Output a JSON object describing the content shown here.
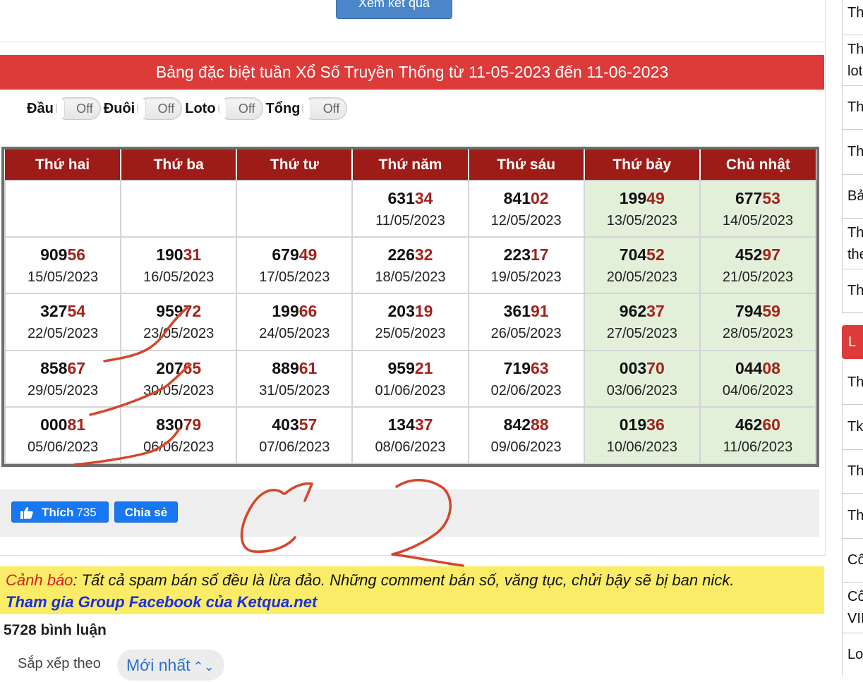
{
  "top": {
    "button_label": "Xem kết quả"
  },
  "banner": {
    "title": "Bảng đặc biệt tuần Xổ Số Truyền Thống từ 11-05-2023 đến 11-06-2023"
  },
  "toggles": [
    {
      "label": "Đầu",
      "state": "Off"
    },
    {
      "label": "Đuôi",
      "state": "Off"
    },
    {
      "label": "Loto",
      "state": "Off"
    },
    {
      "label": "Tổng",
      "state": "Off"
    }
  ],
  "table": {
    "headers": [
      "Thứ hai",
      "Thứ ba",
      "Thứ tư",
      "Thứ năm",
      "Thứ sáu",
      "Thứ bảy",
      "Chủ nhật"
    ],
    "rows": [
      [
        {
          "head": "",
          "tail": "",
          "date": ""
        },
        {
          "head": "",
          "tail": "",
          "date": ""
        },
        {
          "head": "",
          "tail": "",
          "date": ""
        },
        {
          "head": "631",
          "tail": "34",
          "date": "11/05/2023"
        },
        {
          "head": "841",
          "tail": "02",
          "date": "12/05/2023"
        },
        {
          "head": "199",
          "tail": "49",
          "date": "13/05/2023"
        },
        {
          "head": "677",
          "tail": "53",
          "date": "14/05/2023"
        }
      ],
      [
        {
          "head": "909",
          "tail": "56",
          "date": "15/05/2023"
        },
        {
          "head": "190",
          "tail": "31",
          "date": "16/05/2023"
        },
        {
          "head": "679",
          "tail": "49",
          "date": "17/05/2023"
        },
        {
          "head": "226",
          "tail": "32",
          "date": "18/05/2023"
        },
        {
          "head": "223",
          "tail": "17",
          "date": "19/05/2023"
        },
        {
          "head": "704",
          "tail": "52",
          "date": "20/05/2023"
        },
        {
          "head": "452",
          "tail": "97",
          "date": "21/05/2023"
        }
      ],
      [
        {
          "head": "327",
          "tail": "54",
          "date": "22/05/2023"
        },
        {
          "head": "959",
          "tail": "72",
          "date": "23/05/2023"
        },
        {
          "head": "199",
          "tail": "66",
          "date": "24/05/2023"
        },
        {
          "head": "203",
          "tail": "19",
          "date": "25/05/2023"
        },
        {
          "head": "361",
          "tail": "91",
          "date": "26/05/2023"
        },
        {
          "head": "962",
          "tail": "37",
          "date": "27/05/2023"
        },
        {
          "head": "794",
          "tail": "59",
          "date": "28/05/2023"
        }
      ],
      [
        {
          "head": "858",
          "tail": "67",
          "date": "29/05/2023"
        },
        {
          "head": "207",
          "tail": "65",
          "date": "30/05/2023"
        },
        {
          "head": "889",
          "tail": "61",
          "date": "31/05/2023"
        },
        {
          "head": "959",
          "tail": "21",
          "date": "01/06/2023"
        },
        {
          "head": "719",
          "tail": "63",
          "date": "02/06/2023"
        },
        {
          "head": "003",
          "tail": "70",
          "date": "03/06/2023"
        },
        {
          "head": "044",
          "tail": "08",
          "date": "04/06/2023"
        }
      ],
      [
        {
          "head": "000",
          "tail": "81",
          "date": "05/06/2023"
        },
        {
          "head": "830",
          "tail": "79",
          "date": "06/06/2023"
        },
        {
          "head": "403",
          "tail": "57",
          "date": "07/06/2023"
        },
        {
          "head": "134",
          "tail": "37",
          "date": "08/06/2023"
        },
        {
          "head": "842",
          "tail": "88",
          "date": "09/06/2023"
        },
        {
          "head": "019",
          "tail": "36",
          "date": "10/06/2023"
        },
        {
          "head": "462",
          "tail": "60",
          "date": "11/06/2023"
        }
      ]
    ]
  },
  "social": {
    "like_label": "Thích",
    "like_count": "735",
    "share_label": "Chia sẻ",
    "like_icon": "thumbs-up-icon"
  },
  "warning": {
    "label": "Cảnh báo",
    "text": ": Tất cả spam bán số đều là lừa đảo. Những comment bán số, văng tục, chửi bậy sẽ bị ban nick.",
    "link": "Tham gia Group Facebook của Ketqua.net"
  },
  "comments": {
    "count_label": "5728 bình luận",
    "sort_label": "Sắp xếp theo",
    "sort_value": "Mới nhất",
    "sort_icon": "chevron-updown-icon"
  },
  "sidebar": {
    "items": [
      "Th",
      "Th lot",
      "Th",
      "Th",
      "Bả",
      "Th the",
      "Th",
      "Th",
      "Tk",
      "Th",
      "Th",
      "Cô",
      "Cô VII",
      "Lo"
    ],
    "red_item": "L"
  },
  "colors": {
    "banner_red": "#dd3a3a",
    "header_red": "#9e1c17",
    "tail_red": "#a2231c",
    "weekend_green": "#e2f0da",
    "ink": "#d6452a"
  }
}
